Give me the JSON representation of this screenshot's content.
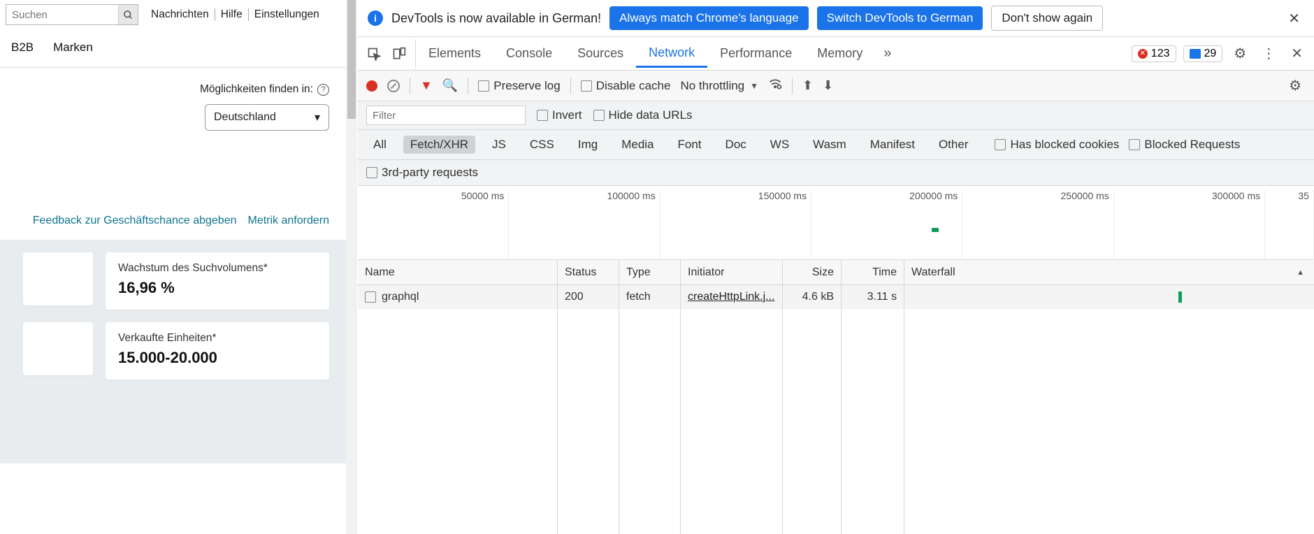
{
  "left": {
    "search_placeholder": "Suchen",
    "links": [
      "Nachrichten",
      "Hilfe",
      "Einstellungen"
    ],
    "nav": [
      "B2B",
      "Marken"
    ],
    "opts_label": "Möglichkeiten finden in:",
    "country": "Deutschland",
    "feedback_link": "Feedback zur Geschäftschance abgeben",
    "metric_link": "Metrik anfordern",
    "card1_title": "Wachstum des Suchvolumens*",
    "card1_value": "16,96 %",
    "card2_title": "Verkaufte Einheiten*",
    "card2_value": "15.000-20.000"
  },
  "infobar": {
    "text": "DevTools is now available in German!",
    "btn_match": "Always match Chrome's language",
    "btn_switch": "Switch DevTools to German",
    "btn_dont": "Don't show again"
  },
  "tabs": {
    "elements": "Elements",
    "console": "Console",
    "sources": "Sources",
    "network": "Network",
    "performance": "Performance",
    "memory": "Memory"
  },
  "counts": {
    "errors": "123",
    "msgs": "29"
  },
  "toolbar": {
    "preserve": "Preserve log",
    "disable": "Disable cache",
    "throttling": "No throttling"
  },
  "filter": {
    "placeholder": "Filter",
    "invert": "Invert",
    "hide": "Hide data URLs",
    "blockedCookies": "Has blocked cookies",
    "blockedReq": "Blocked Requests",
    "thirdparty": "3rd-party requests"
  },
  "types": [
    "All",
    "Fetch/XHR",
    "JS",
    "CSS",
    "Img",
    "Media",
    "Font",
    "Doc",
    "WS",
    "Wasm",
    "Manifest",
    "Other"
  ],
  "timeline": [
    "50000 ms",
    "100000 ms",
    "150000 ms",
    "200000 ms",
    "250000 ms",
    "300000 ms",
    "35"
  ],
  "headers": {
    "name": "Name",
    "status": "Status",
    "type": "Type",
    "initiator": "Initiator",
    "size": "Size",
    "time": "Time",
    "waterfall": "Waterfall"
  },
  "row": {
    "name": "graphql",
    "status": "200",
    "type": "fetch",
    "initiator": "createHttpLink.j...",
    "size": "4.6 kB",
    "time": "3.11 s"
  }
}
